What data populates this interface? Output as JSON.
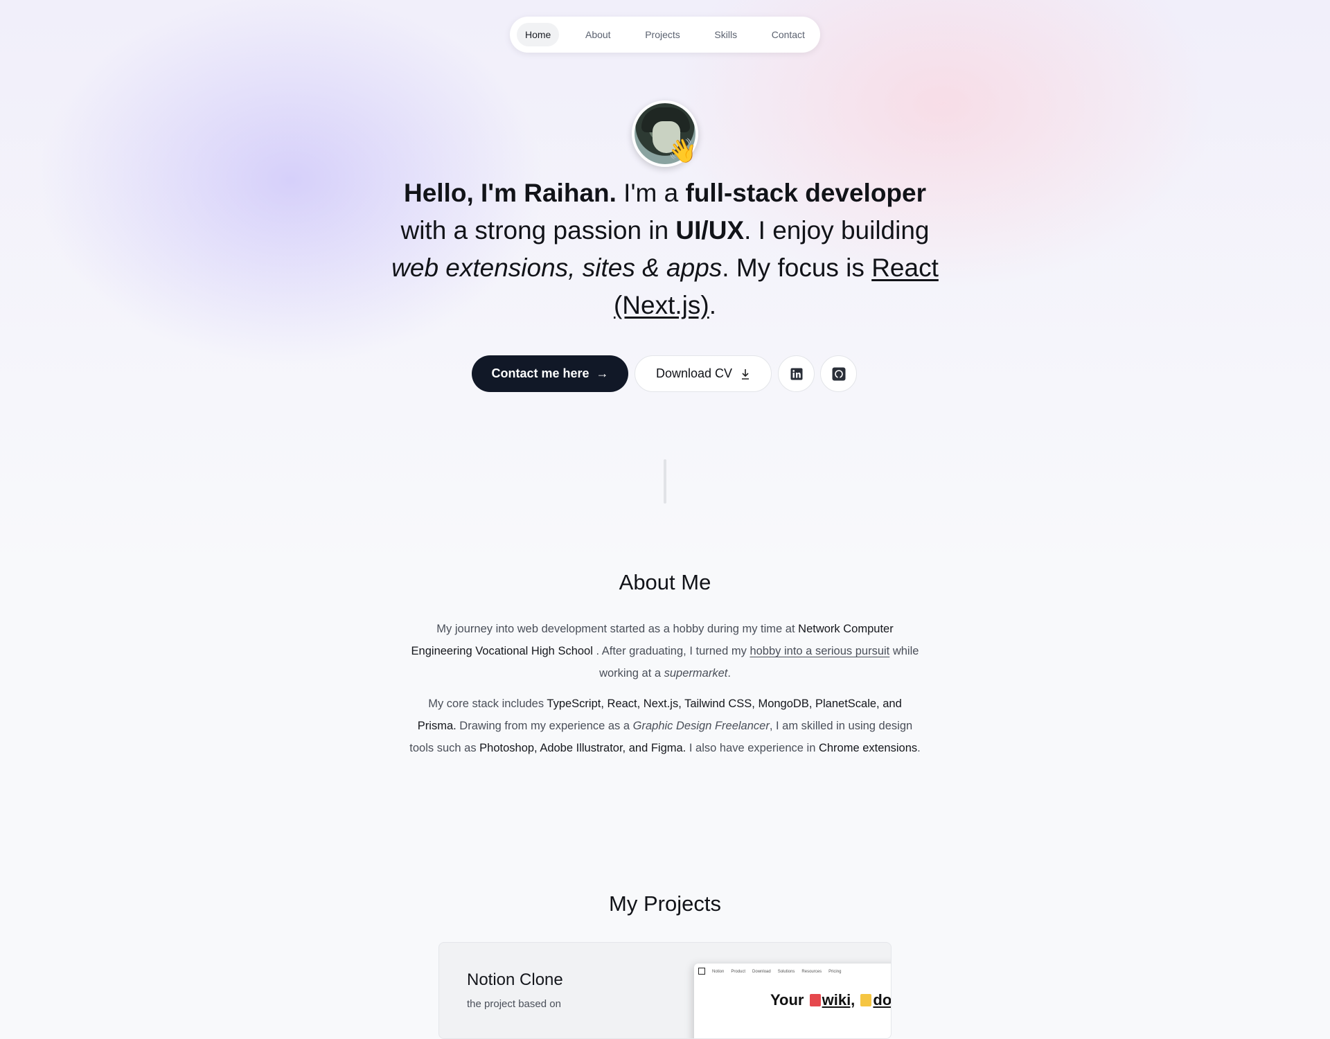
{
  "nav": {
    "items": [
      {
        "label": "Home",
        "active": true
      },
      {
        "label": "About",
        "active": false
      },
      {
        "label": "Projects",
        "active": false
      },
      {
        "label": "Skills",
        "active": false
      },
      {
        "label": "Contact",
        "active": false
      }
    ]
  },
  "hero": {
    "greeting": "Hello, I'm Raihan.",
    "text1": " I'm a ",
    "role": "full-stack developer",
    "text2": " with a strong passion in ",
    "passion": "UI/UX",
    "text3": ". I enjoy building ",
    "builds": "web extensions, sites & apps",
    "text4": ". My focus is ",
    "focus": "React (Next.js)",
    "text5": ".",
    "wave_emoji": "👋"
  },
  "actions": {
    "contact_label": "Contact me here",
    "contact_icon": "→",
    "cv_label": "Download CV",
    "linkedin_icon": "linkedin-icon",
    "github_icon": "github-icon"
  },
  "about": {
    "title": "About Me",
    "p1_a": "My journey into web development started as a hobby during my time at ",
    "p1_school": "Network Computer Engineering Vocational High School",
    "p1_b": " . After graduating, I turned my ",
    "p1_link": "hobby into a serious pursuit",
    "p1_c": " while working at a ",
    "p1_place": "supermarket",
    "p1_d": ".",
    "p2_a": "My core stack includes ",
    "p2_stack": "TypeScript, React, Next.js, Tailwind CSS, MongoDB, PlanetScale, and Prisma.",
    "p2_b": " Drawing from my experience as a ",
    "p2_role": "Graphic Design Freelancer",
    "p2_c": ", I am skilled in using design tools such as ",
    "p2_tools": "Photoshop, Adobe Illustrator, and Figma.",
    "p2_d": " I also have experience in ",
    "p2_ext": "Chrome extensions",
    "p2_e": "."
  },
  "projects": {
    "title": "My Projects",
    "items": [
      {
        "title": "Notion Clone",
        "description": "the project based on",
        "preview": {
          "nav": [
            "Notion",
            "Product",
            "Download",
            "Solutions",
            "Resources",
            "Pricing"
          ],
          "headline_a": "Your",
          "headline_wiki": "wiki,",
          "headline_do": "do"
        }
      }
    ]
  },
  "colors": {
    "primary_button": "#111827",
    "accent_red": "#e5484d",
    "accent_yellow": "#f5c542"
  }
}
